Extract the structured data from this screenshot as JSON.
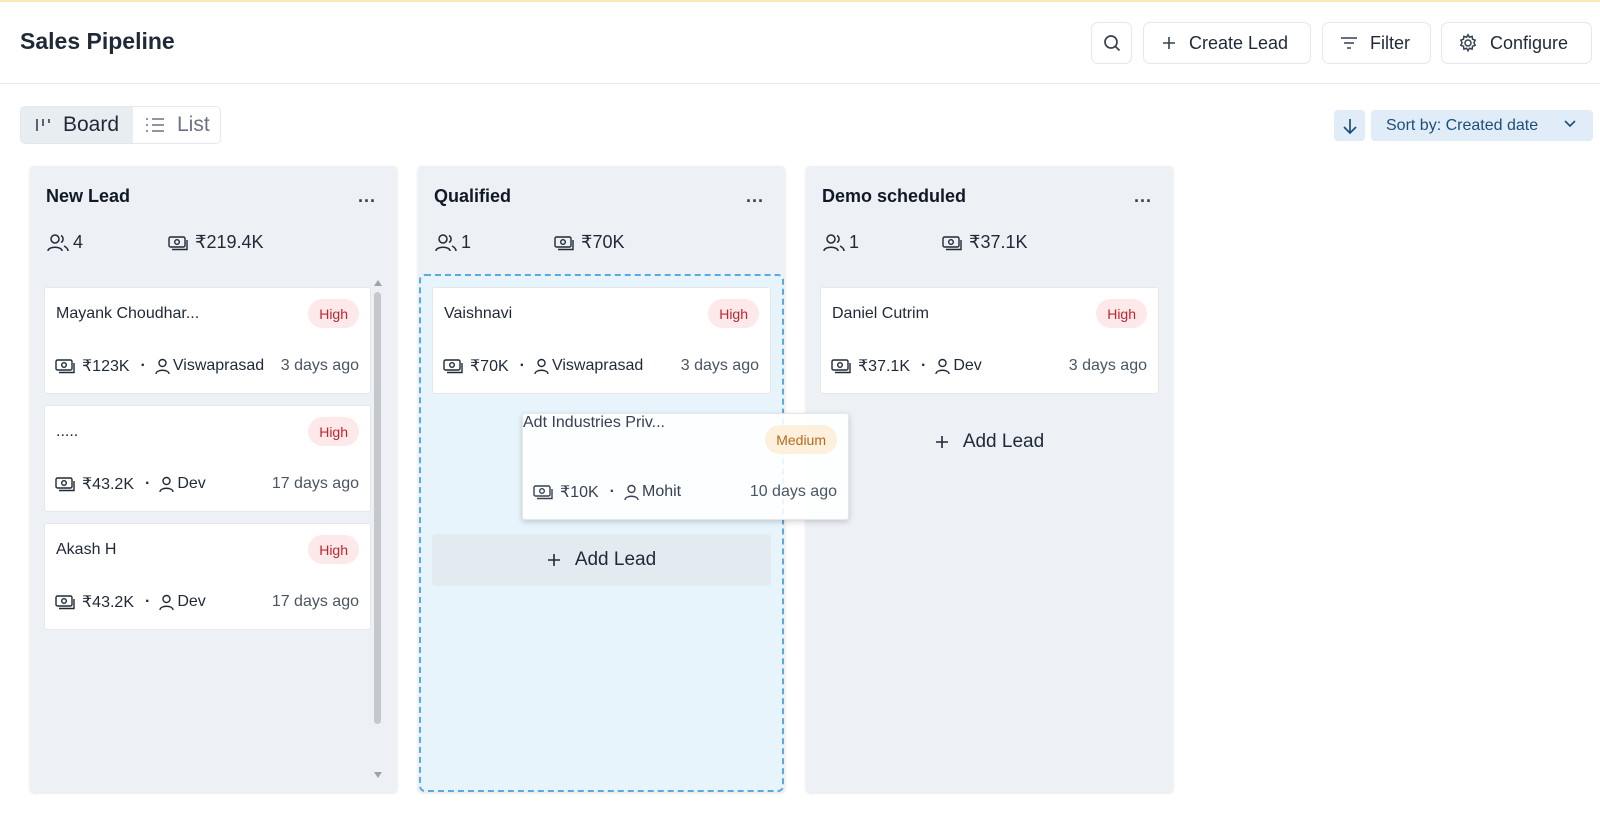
{
  "header": {
    "title": "Sales Pipeline",
    "create_label": "Create Lead",
    "filter_label": "Filter",
    "configure_label": "Configure"
  },
  "view": {
    "board_label": "Board",
    "list_label": "List",
    "active": "Board"
  },
  "sort": {
    "label": "Sort by: Created date",
    "direction": "descending"
  },
  "columns": [
    {
      "title": "New Lead",
      "count": "4",
      "total": "₹219.4K",
      "more": "...",
      "cards": [
        {
          "name": "Mayank Choudhar...",
          "priority": "High",
          "amount": "₹123K",
          "owner": "Viswaprasad",
          "ago": "3 days ago"
        },
        {
          "name": ".....",
          "priority": "High",
          "amount": "₹43.2K",
          "owner": "Dev",
          "ago": "17 days ago"
        },
        {
          "name": "Akash H",
          "priority": "High",
          "amount": "₹43.2K",
          "owner": "Dev",
          "ago": "17 days ago"
        }
      ]
    },
    {
      "title": "Qualified",
      "count": "1",
      "total": "₹70K",
      "more": "...",
      "cards": [
        {
          "name": "Vaishnavi",
          "priority": "High",
          "amount": "₹70K",
          "owner": "Viswaprasad",
          "ago": "3 days ago"
        }
      ],
      "add_label": "Add Lead"
    },
    {
      "title": "Demo scheduled",
      "count": "1",
      "total": "₹37.1K",
      "more": "...",
      "cards": [
        {
          "name": "Daniel Cutrim",
          "priority": "High",
          "amount": "₹37.1K",
          "owner": "Dev",
          "ago": "3 days ago"
        }
      ],
      "add_label": "Add Lead"
    }
  ],
  "dragging_card": {
    "name": "Adt Industries Priv...",
    "priority": "Medium",
    "amount": "₹10K",
    "owner": "Mohit",
    "ago": "10 days ago"
  },
  "colors": {
    "accent": "#1e4e79",
    "high_badge": "#c0262d",
    "medium_badge": "#b86a1d",
    "drop_border": "#5aa9e0"
  },
  "icons": {
    "search": "search-icon",
    "create": "plus-icon",
    "filter": "filter-icon",
    "configure": "gear-icon",
    "board": "board-icon",
    "list": "list-icon",
    "people": "people-icon",
    "money": "money-icon",
    "user": "user-icon"
  }
}
